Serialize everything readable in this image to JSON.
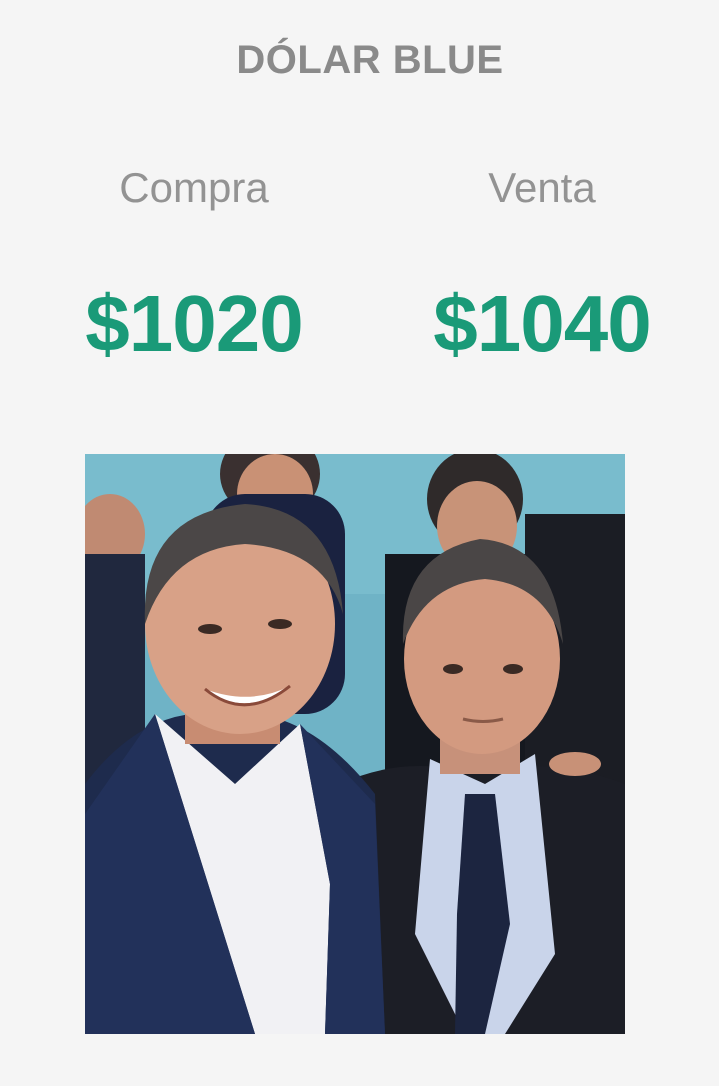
{
  "header": {
    "title": "DÓLAR BLUE"
  },
  "rates": {
    "buy": {
      "label": "Compra",
      "value": "$1020"
    },
    "sell": {
      "label": "Venta",
      "value": "$1040"
    }
  },
  "photo": {
    "icon": "photo-two-men",
    "colors": {
      "background": "#6fb3c6",
      "suit_left": "#1e2b4d",
      "suit_right": "#1c1e26",
      "shirt_left": "#f1f1f4",
      "shirt_right": "#c9d4ea",
      "tie": "#1c2540",
      "skin": "#d39a80",
      "hair": "#4a4646"
    }
  },
  "colors": {
    "page_background": "#f5f5f5",
    "title": "#8a8a8a",
    "label": "#939393",
    "value": "#1a9a78"
  }
}
